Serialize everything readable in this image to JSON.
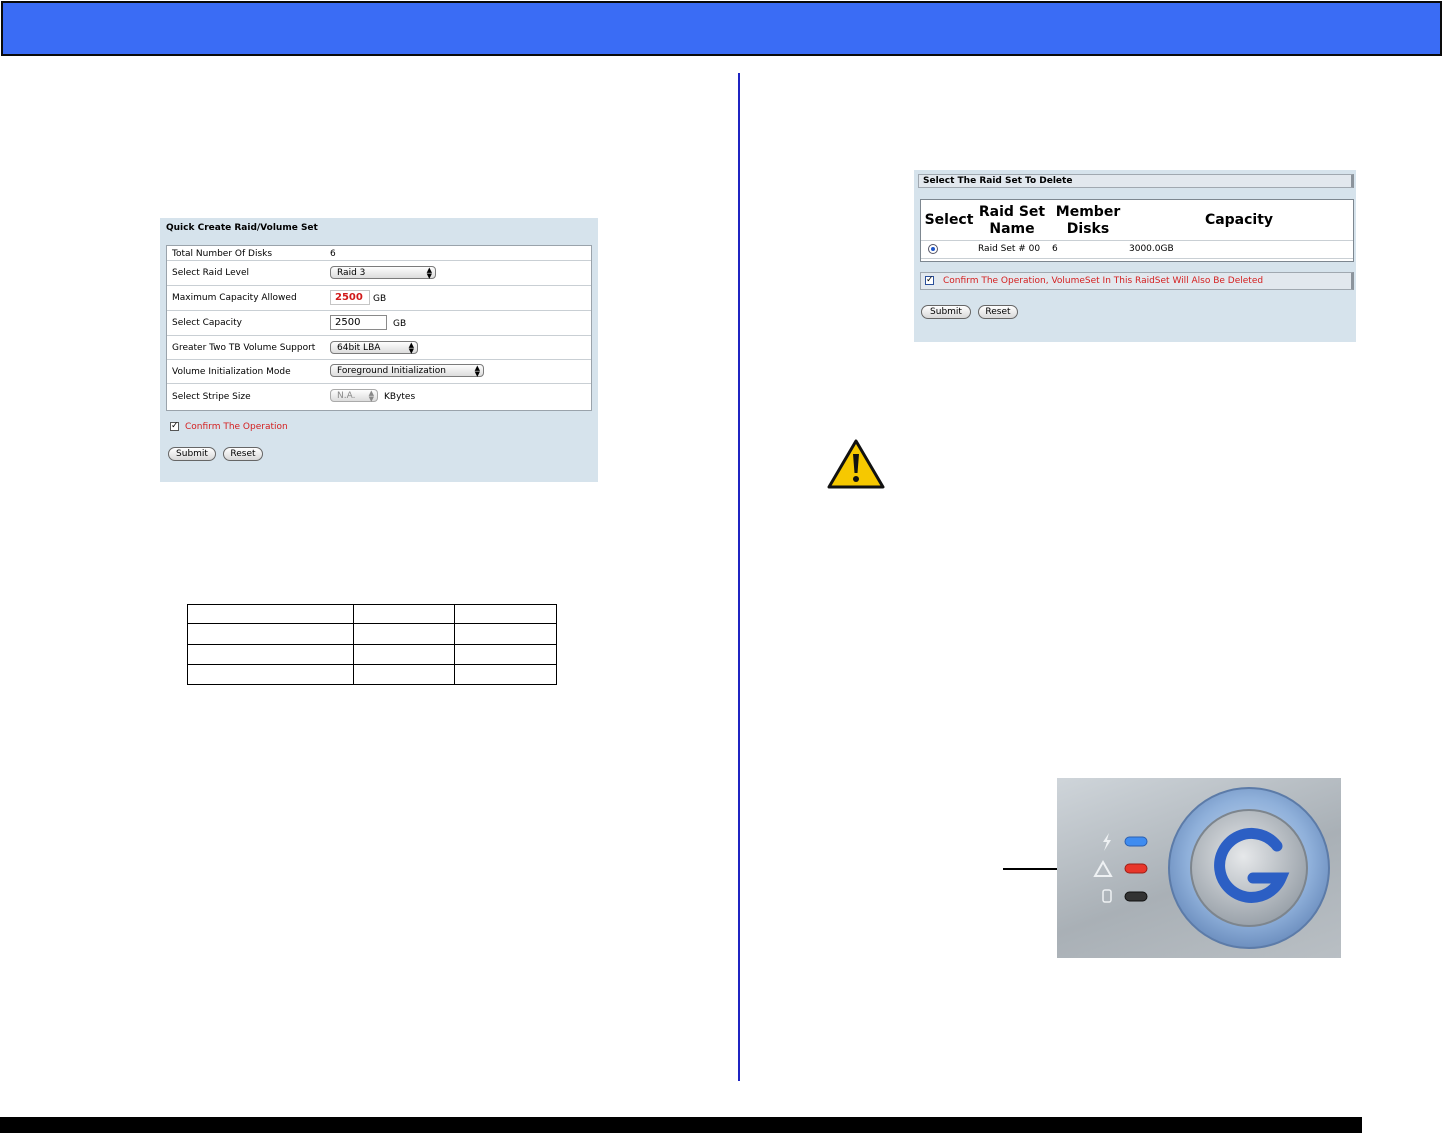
{
  "quick_create": {
    "title": "Quick Create Raid/Volume Set",
    "rows": [
      {
        "label": "Total Number Of Disks",
        "value": "6"
      },
      {
        "label": "Select Raid Level",
        "value": "Raid 3"
      },
      {
        "label": "Maximum Capacity Allowed",
        "value": "2500",
        "unit": "GB"
      },
      {
        "label": "Select Capacity",
        "value": "2500",
        "unit": "GB"
      },
      {
        "label": "Greater Two TB Volume Support",
        "value": "64bit LBA"
      },
      {
        "label": "Volume Initialization Mode",
        "value": "Foreground Initialization"
      },
      {
        "label": "Select Stripe Size",
        "value": "N.A.",
        "unit": "KBytes"
      }
    ],
    "confirm_label": "Confirm The Operation",
    "submit_label": "Submit",
    "reset_label": "Reset"
  },
  "delete_raid": {
    "title": "Select The Raid Set To Delete",
    "headers": {
      "select": "Select",
      "name": "Raid Set Name",
      "members": "Member Disks",
      "capacity": "Capacity"
    },
    "rows": [
      {
        "name": "Raid Set # 00",
        "members": "6",
        "capacity": "3000.0GB"
      }
    ],
    "confirm_label": "Confirm The Operation, VolumeSet In This RaidSet Will Also Be Deleted",
    "submit_label": "Submit",
    "reset_label": "Reset"
  },
  "colors": {
    "banner": "#3a6cf5",
    "divider": "#1f24c2",
    "warning": "#f6c800",
    "alert_led": "#e8362a",
    "power_led": "#3f8cf0"
  }
}
